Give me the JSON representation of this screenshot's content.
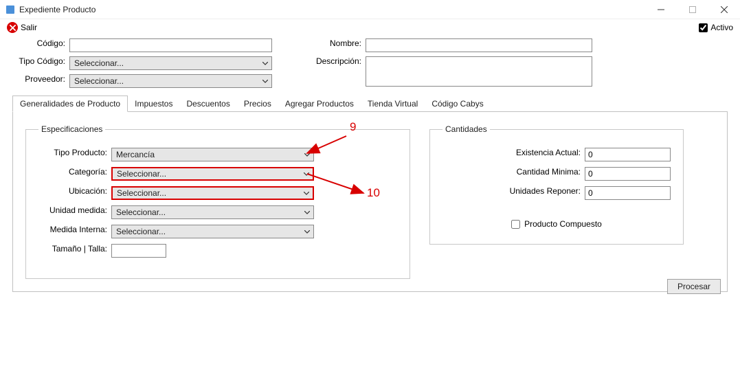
{
  "window": {
    "title": "Expediente Producto"
  },
  "toolbar": {
    "salir": "Salir",
    "activo": "Activo",
    "activo_checked": true
  },
  "header": {
    "codigo_label": "Código:",
    "tipo_codigo_label": "Tipo Código:",
    "proveedor_label": "Proveedor:",
    "nombre_label": "Nombre:",
    "descripcion_label": "Descripción:",
    "codigo_value": "",
    "tipo_codigo_value": "Seleccionar...",
    "proveedor_value": "Seleccionar...",
    "nombre_value": "",
    "descripcion_value": ""
  },
  "tabs": [
    {
      "label": "Generalidades de Producto",
      "active": true
    },
    {
      "label": "Impuestos",
      "active": false
    },
    {
      "label": "Descuentos",
      "active": false
    },
    {
      "label": "Precios",
      "active": false
    },
    {
      "label": "Agregar Productos",
      "active": false
    },
    {
      "label": "Tienda Virtual",
      "active": false
    },
    {
      "label": "Código Cabys",
      "active": false
    }
  ],
  "especificaciones": {
    "legend": "Especificaciones",
    "tipo_producto_label": "Tipo Producto:",
    "categoria_label": "Categoría:",
    "ubicacion_label": "Ubicación:",
    "unidad_medida_label": "Unidad medida:",
    "medida_interna_label": "Medida Interna:",
    "tamano_label": "Tamaño | Talla:",
    "tipo_producto_value": "Mercancía",
    "categoria_value": "Seleccionar...",
    "ubicacion_value": "Seleccionar...",
    "unidad_medida_value": "Seleccionar...",
    "medida_interna_value": "Seleccionar...",
    "tamano_value": ""
  },
  "cantidades": {
    "legend": "Cantidades",
    "existencia_label": "Existencia Actual:",
    "minima_label": "Cantidad Minima:",
    "reponer_label": "Unidades Reponer:",
    "existencia_value": "0",
    "minima_value": "0",
    "reponer_value": "0",
    "producto_compuesto_label": "Producto Compuesto",
    "producto_compuesto_checked": false
  },
  "buttons": {
    "procesar": "Procesar"
  },
  "annotations": {
    "color": "#d80000",
    "callout_9": "9",
    "callout_10": "10"
  }
}
